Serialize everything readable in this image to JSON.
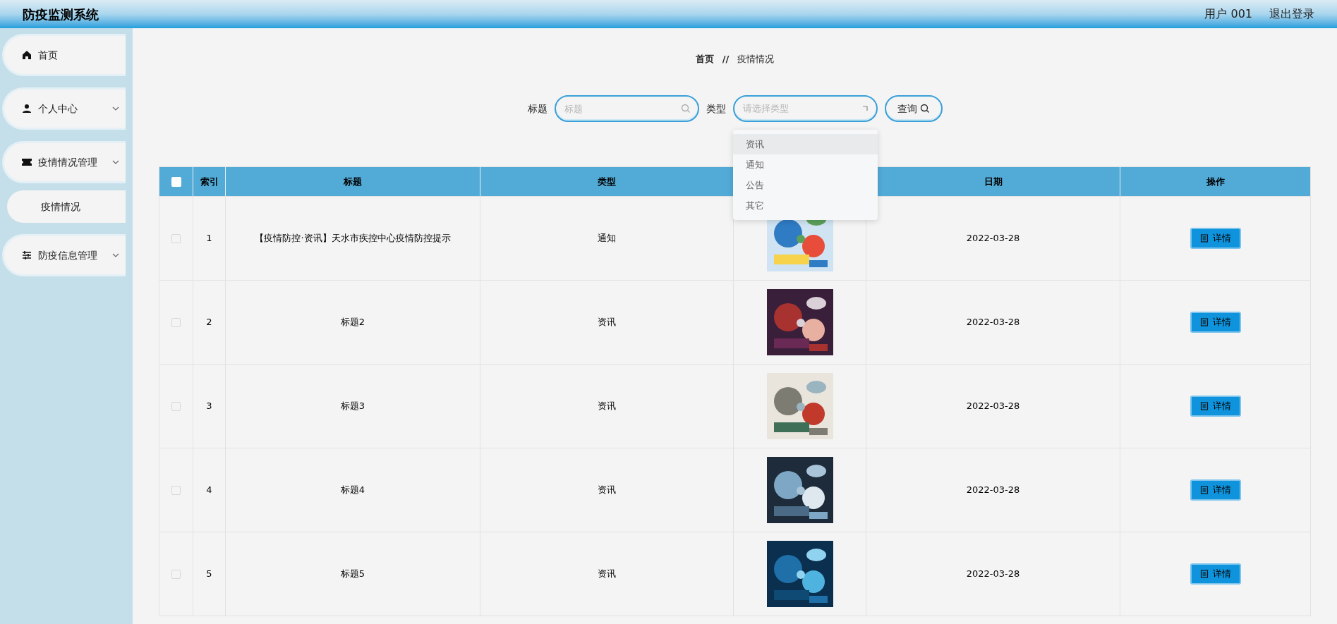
{
  "header": {
    "title": "防疫监测系统",
    "user": "用户 001",
    "logout": "退出登录"
  },
  "sidebar": {
    "items": [
      {
        "label": "首页",
        "has_submenu": false
      },
      {
        "label": "个人中心",
        "has_submenu": true
      },
      {
        "label": "疫情情况管理",
        "has_submenu": true,
        "children": [
          {
            "label": "疫情情况"
          }
        ]
      },
      {
        "label": "防疫信息管理",
        "has_submenu": true
      }
    ]
  },
  "breadcrumb": {
    "items": [
      "首页",
      "疫情情况"
    ],
    "separator": "//"
  },
  "search": {
    "title_label": "标题",
    "title_placeholder": "标题",
    "type_label": "类型",
    "type_placeholder": "请选择类型",
    "button": "查询"
  },
  "dropdown": {
    "options": [
      {
        "label": "资讯",
        "hovered": true
      },
      {
        "label": "通知",
        "hovered": false
      },
      {
        "label": "公告",
        "hovered": false
      },
      {
        "label": "其它",
        "hovered": false
      }
    ]
  },
  "table": {
    "columns": [
      "索引",
      "标题",
      "类型",
      "日期",
      "操作"
    ],
    "all_checked": false,
    "rows": [
      {
        "index": "1",
        "title": "【疫情防控·资讯】天水市疾控中心疫情防控提示",
        "type": "通知",
        "date": "2022-03-28",
        "action": "详情",
        "checked": false
      },
      {
        "index": "2",
        "title": "标题2",
        "type": "资讯",
        "date": "2022-03-28",
        "action": "详情",
        "checked": false
      },
      {
        "index": "3",
        "title": "标题3",
        "type": "资讯",
        "date": "2022-03-28",
        "action": "详情",
        "checked": false
      },
      {
        "index": "4",
        "title": "标题4",
        "type": "资讯",
        "date": "2022-03-28",
        "action": "详情",
        "checked": false
      },
      {
        "index": "5",
        "title": "标题5",
        "type": "资讯",
        "date": "2022-03-28",
        "action": "详情",
        "checked": false
      }
    ]
  }
}
